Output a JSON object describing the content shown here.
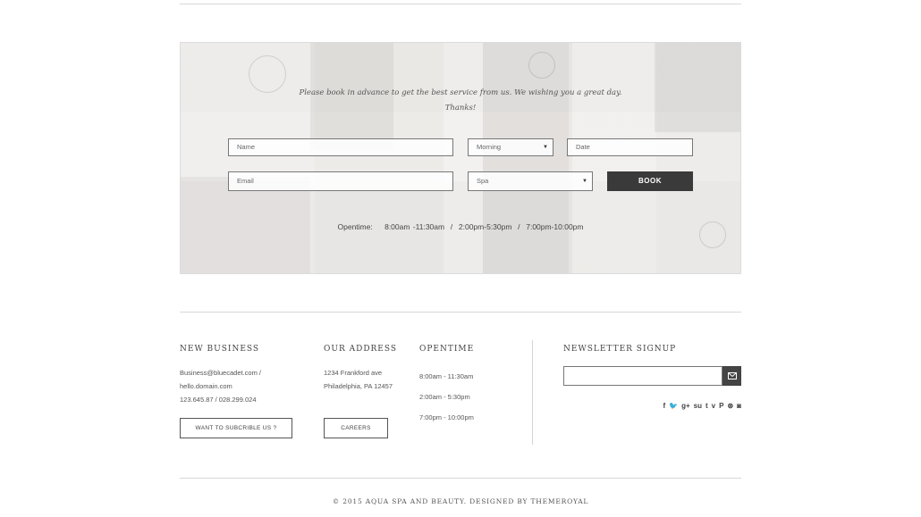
{
  "booking": {
    "message_line1": "Please book in advance to get the best service from us. We wishing you a great day.",
    "message_line2": "Thanks!",
    "name_placeholder": "Name",
    "time_select_value": "Morning",
    "date_placeholder": "Date",
    "email_placeholder": "Email",
    "service_select_value": "Spa",
    "book_label": "BOOK",
    "opentime_label": "Opentime:",
    "opentime_value": "8:00am -11:30am  /  2:00pm-5:30pm  /  7:00pm-10:00pm"
  },
  "footer": {
    "new_business": {
      "title": "NEW BUSINESS",
      "line1": "Business@bluecadet.com /",
      "line2": "hello.domain.com",
      "line3": "123.645.87 / 028.299.024",
      "button": "WANT TO SUBCRIBLE US ?"
    },
    "address": {
      "title": "OUR ADDRESS",
      "line1": "1234 Frankford ave",
      "line2": "Philadelphia, PA 12457",
      "button": "CAREERS"
    },
    "opentime": {
      "title": "OPENTIME",
      "line1": "8:00am - 11:30am",
      "line2": "2:00am - 5:30pm",
      "line3": "7:00pm - 10:00pm"
    },
    "newsletter": {
      "title": "NEWSLETTER SIGNUP",
      "input_value": "",
      "submit_icon": "mail-icon"
    },
    "social": [
      {
        "icon": "facebook-icon",
        "glyph": "f"
      },
      {
        "icon": "twitter-icon",
        "glyph": "🐦"
      },
      {
        "icon": "google-plus-icon",
        "glyph": "g+"
      },
      {
        "icon": "stumbleupon-icon",
        "glyph": "su"
      },
      {
        "icon": "tumblr-icon",
        "glyph": "t"
      },
      {
        "icon": "vimeo-icon",
        "glyph": "v"
      },
      {
        "icon": "pinterest-icon",
        "glyph": "P"
      },
      {
        "icon": "dribbble-icon",
        "glyph": "⊛"
      },
      {
        "icon": "instagram-icon",
        "glyph": "◙"
      }
    ],
    "copyright": "© 2015 AQUA SPA AND BEAUTY. DESIGNED BY THEMEROYAL"
  }
}
